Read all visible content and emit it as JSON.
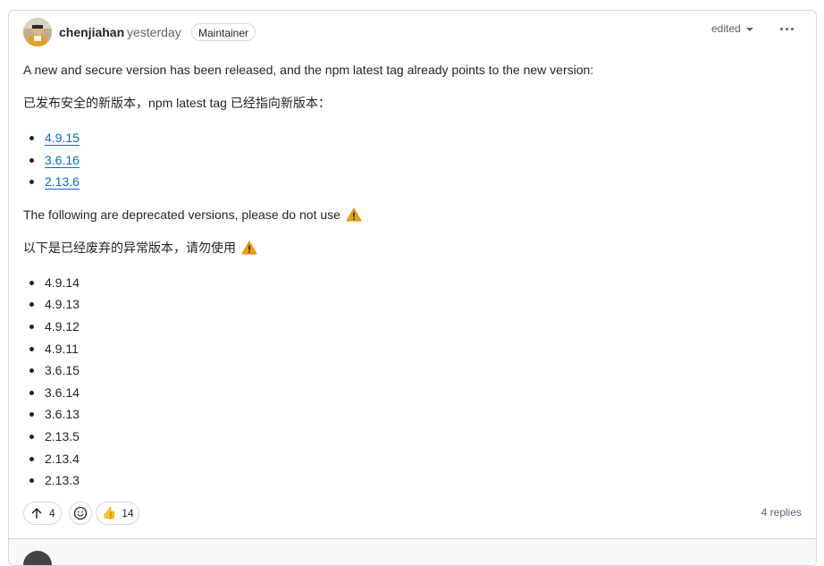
{
  "comment": {
    "author": "chenjiahan",
    "time": "yesterday",
    "badge": "Maintainer",
    "edited_label": "edited",
    "paragraph_en_1": "A new and secure version has been released, and the npm latest tag already points to the new version:",
    "paragraph_zh_1": "已发布安全的新版本，npm latest tag 已经指向新版本：",
    "safe_versions": [
      "4.9.15",
      "3.6.16",
      "2.13.6"
    ],
    "paragraph_en_2": "The following are deprecated versions, please do not use",
    "paragraph_zh_2": "以下是已经废弃的异常版本，请勿使用",
    "deprecated_versions": [
      "4.9.14",
      "4.9.13",
      "4.9.12",
      "4.9.11",
      "3.6.15",
      "3.6.14",
      "3.6.13",
      "2.13.5",
      "2.13.4",
      "2.13.3"
    ]
  },
  "reactions": {
    "upvote_count": "4",
    "thumbs_up_emoji": "👍",
    "thumbs_up_count": "14"
  },
  "replies_label": "4 replies",
  "icons": {
    "warning": "warning-icon",
    "upvote": "arrow-up-icon",
    "add_reaction": "smiley-icon",
    "more": "kebab-horizontal-icon",
    "caret": "triangle-down-icon"
  },
  "colors": {
    "link": "#0969da",
    "border": "#d1d9e0",
    "muted": "#59636e",
    "warning": "#f0a000"
  }
}
